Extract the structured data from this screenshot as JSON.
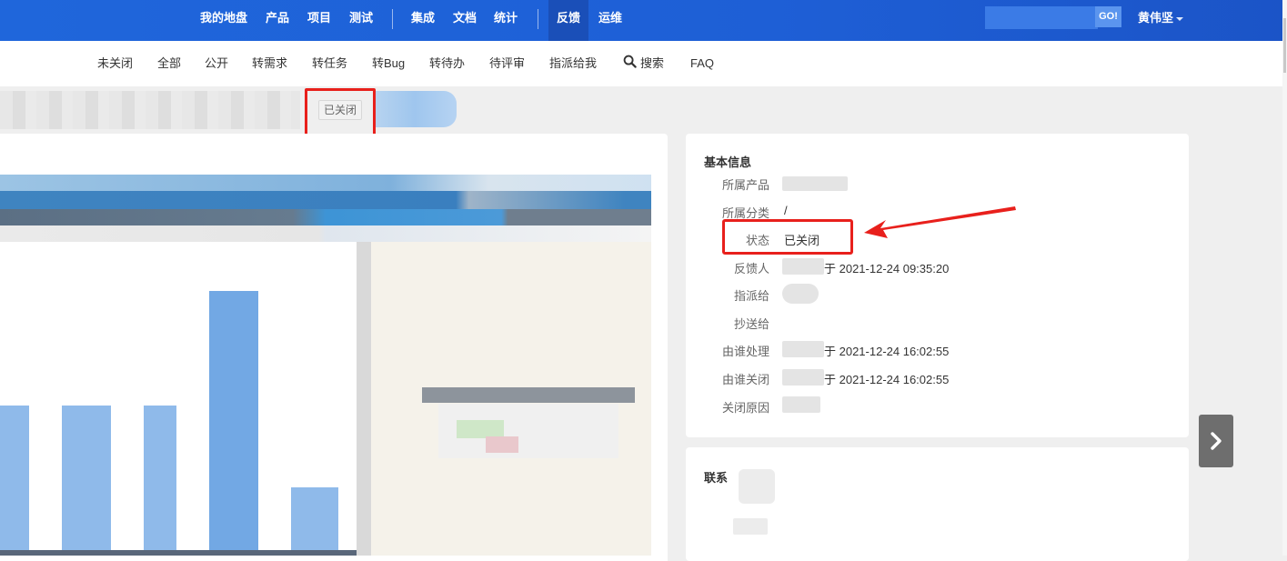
{
  "header": {
    "nav": [
      {
        "label": "我的地盘"
      },
      {
        "label": "产品"
      },
      {
        "label": "项目"
      },
      {
        "label": "测试"
      },
      {
        "label": "集成"
      },
      {
        "label": "文档"
      },
      {
        "label": "统计"
      },
      {
        "label": "反馈",
        "active": true
      },
      {
        "label": "运维"
      }
    ],
    "search_go_label": "GO!",
    "user_name": "黄伟坚"
  },
  "subnav": [
    {
      "label": "未关闭"
    },
    {
      "label": "全部"
    },
    {
      "label": "公开"
    },
    {
      "label": "转需求"
    },
    {
      "label": "转任务"
    },
    {
      "label": "转Bug"
    },
    {
      "label": "转待办"
    },
    {
      "label": "待评审"
    },
    {
      "label": "指派给我"
    },
    {
      "label": "搜索",
      "icon": "search-icon"
    },
    {
      "label": "FAQ"
    }
  ],
  "title_status_tag": "已关闭",
  "basic_info": {
    "title": "基本信息",
    "rows": [
      {
        "label": "所属产品",
        "value": ""
      },
      {
        "label": "所属分类",
        "value": "/"
      },
      {
        "label": "状态",
        "value": "已关闭"
      },
      {
        "label": "反馈人",
        "value": "于 2021-12-24 09:35:20"
      },
      {
        "label": "指派给",
        "value": ""
      },
      {
        "label": "抄送给",
        "value": ""
      },
      {
        "label": "由谁处理",
        "value": "于 2021-12-24 16:02:55"
      },
      {
        "label": "由谁关闭",
        "value": "于 2021-12-24 16:02:55"
      },
      {
        "label": "关闭原因",
        "value": ""
      }
    ]
  },
  "contact": {
    "title": "联系"
  },
  "colors": {
    "header_bg": "#1f66db",
    "active_nav_bg": "#1a4fb8",
    "highlight_red": "#e8201c",
    "panel_bg": "#ffffff",
    "page_bg": "#efefef"
  }
}
